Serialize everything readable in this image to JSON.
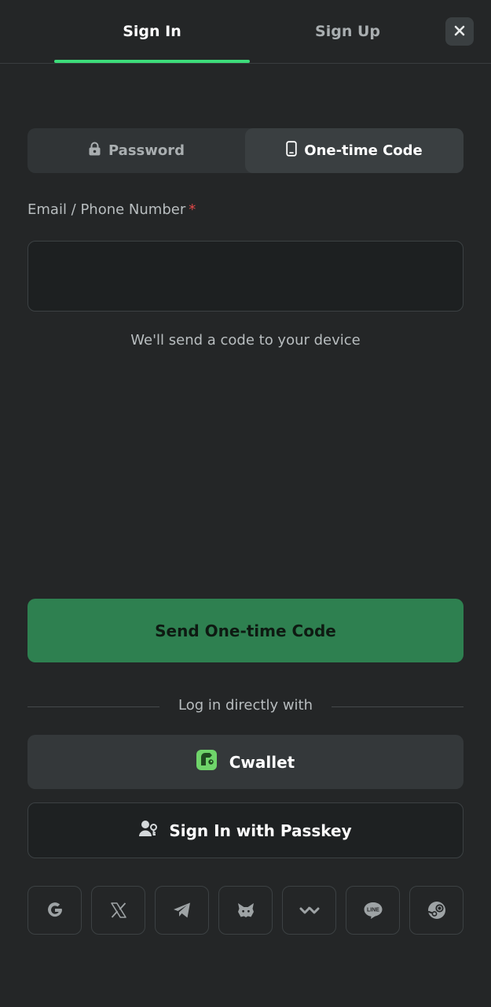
{
  "header": {
    "tabs": [
      {
        "label": "Sign In",
        "active": true
      },
      {
        "label": "Sign Up",
        "active": false
      }
    ],
    "close_icon": "close-icon",
    "accent_color": "#3ddc7a"
  },
  "login_method": {
    "options": [
      {
        "label": "Password",
        "icon": "lock-icon",
        "selected": false
      },
      {
        "label": "One-time Code",
        "icon": "phone-icon",
        "selected": true
      }
    ]
  },
  "form": {
    "email_label": "Email / Phone Number",
    "required_marker": "*",
    "email_value": "",
    "helper_text": "We'll send a code to your device",
    "submit_label": "Send One-time Code",
    "submit_color": "#2e8050"
  },
  "alternatives": {
    "divider_text": "Log in directly with",
    "cwallet_label": "Cwallet",
    "passkey_label": "Sign In with Passkey",
    "social": [
      {
        "name": "google",
        "icon": "google-icon"
      },
      {
        "name": "x",
        "icon": "x-icon"
      },
      {
        "name": "telegram",
        "icon": "telegram-icon"
      },
      {
        "name": "metamask",
        "icon": "metamask-icon"
      },
      {
        "name": "walletconnect",
        "icon": "walletconnect-icon"
      },
      {
        "name": "line",
        "icon": "line-icon",
        "badge_text": "LINE"
      },
      {
        "name": "steam",
        "icon": "steam-icon"
      }
    ]
  }
}
